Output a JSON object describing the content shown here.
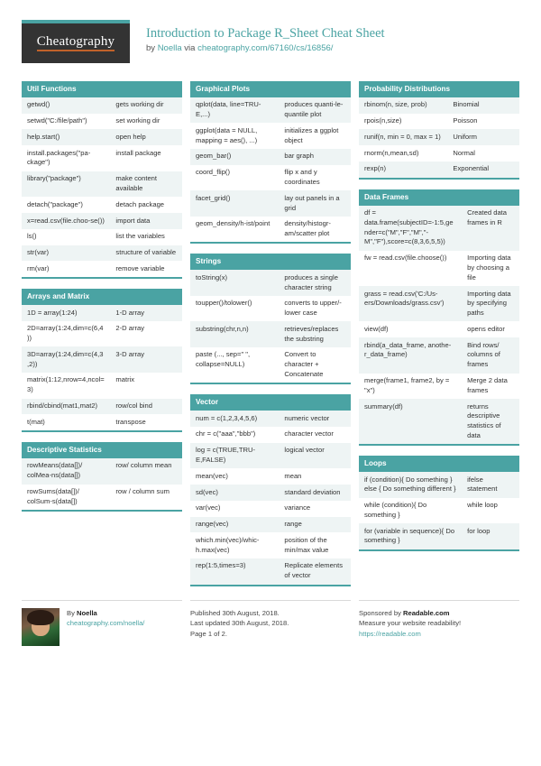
{
  "header": {
    "logo": "Cheatography",
    "title": "Introduction to Package R_Sheet Cheat Sheet",
    "by_prefix": "by ",
    "author": "Noella",
    "via": " via ",
    "source_url": "cheatography.com/67160/cs/16856/"
  },
  "columns": [
    {
      "name": "column-left",
      "blocks": [
        {
          "title": "Util Functions",
          "rows": [
            [
              "getwd()",
              "gets working dir"
            ],
            [
              "setwd(\"C:/file/path\")",
              "set working dir"
            ],
            [
              "help.start()",
              "open help"
            ],
            [
              "install.packages(\"pa-ckage\")",
              "install package"
            ],
            [
              "library(\"package\")",
              "make content available"
            ],
            [
              "detach(\"package\")",
              "detach package"
            ],
            [
              "x=read.csv(file.choo-se())",
              "import data"
            ],
            [
              "ls()",
              "list the variables"
            ],
            [
              "str(var)",
              "structure of variable"
            ],
            [
              "rm(var)",
              "remove variable"
            ]
          ]
        },
        {
          "title": "Arrays and Matrix",
          "rows": [
            [
              "1D = array(1:24)",
              "1-D array"
            ],
            [
              "2D=array(1:24,dim=c(6,4))",
              "2-D array"
            ],
            [
              "3D=array(1:24,dim=c(4,3,2))",
              "3-D array"
            ],
            [
              "matrix(1:12,nrow=4,ncol=3)",
              "matrix"
            ],
            [
              "rbind/cbind(mat1,mat2)",
              "row/col bind"
            ],
            [
              "t(mat)",
              "transpose"
            ]
          ]
        },
        {
          "title": "Descriptive Statistics",
          "rows": [
            [
              "rowMeans(data[])/ colMea-ns(data[])",
              "row/ column mean"
            ],
            [
              "rowSums(data[])/ colSum-s(data[])",
              "row / column sum"
            ]
          ]
        }
      ]
    },
    {
      "name": "column-middle",
      "blocks": [
        {
          "title": "Graphical Plots",
          "rows": [
            [
              "qplot(data, line=TRU-E,...)",
              "produces quanti-le-quantile plot"
            ],
            [
              "ggplot(data = NULL, mapping = aes(), ...)",
              "initializes a ggplot object"
            ],
            [
              "geom_bar()",
              "bar graph"
            ],
            [
              "coord_flip()",
              "flip x and y coordinates"
            ],
            [
              "facet_grid()",
              "lay out panels in a grid"
            ],
            [
              "geom_density/h-ist/point",
              "density/histogr-am/scatter plot"
            ]
          ]
        },
        {
          "title": "Strings",
          "rows": [
            [
              "toString(x)",
              "produces a single character string"
            ],
            [
              "toupper()/tolower()",
              "converts to upper/-lower case"
            ],
            [
              "substring(chr,n,n)",
              "retrieves/replaces the substring"
            ],
            [
              "paste (..., sep=\" \", collapse=NULL)",
              "Convert to character + Concatenate"
            ]
          ]
        },
        {
          "title": "Vector",
          "rows": [
            [
              "num = c(1,2,3,4,5,6)",
              "numeric vector"
            ],
            [
              "chr = c(\"aaa\",\"bbb\")",
              "character vector"
            ],
            [
              "log = c(TRUE,TRU-E,FALSE)",
              "logical vector"
            ],
            [
              "mean(vec)",
              "mean"
            ],
            [
              "sd(vec)",
              "standard deviation"
            ],
            [
              "var(vec)",
              "variance"
            ],
            [
              "range(vec)",
              "range"
            ],
            [
              "which.min(vec)/whic-h.max(vec)",
              "position of the min/max value"
            ],
            [
              "rep(1:5,times=3)",
              "Replicate elements of vector"
            ]
          ]
        }
      ]
    },
    {
      "name": "column-right",
      "blocks": [
        {
          "title": "Probability Distributions",
          "wide": false,
          "rows": [
            [
              "rbinom(n, size, prob)",
              "Binomial"
            ],
            [
              "rpois(n,size)",
              "Poisson"
            ],
            [
              "runif(n, min = 0, max = 1)",
              "Uniform"
            ],
            [
              "rnorm(n,mean,sd)",
              "Normal"
            ],
            [
              "rexp(n)",
              "Exponential"
            ]
          ]
        },
        {
          "title": "Data Frames",
          "wide": true,
          "rows": [
            [
              "df = data.frame(subjectID=-1:5,gender=c(\"M\",\"F\",\"M\",\"-M\",\"F\"),score=c(8,3,6,5,5))",
              "Created data frames in R"
            ],
            [
              "fw = read.csv(file.choose())",
              "Importing data by choosing a file"
            ],
            [
              "grass = read.csv('C:/Us-ers/Downloads/grass.csv')",
              "Importing data by specifying paths"
            ],
            [
              "view(df)",
              "opens editor"
            ],
            [
              "rbind(a_data_frame, anothe-r_data_frame)",
              "Bind rows/ columns of frames"
            ],
            [
              "merge(frame1, frame2, by = \"x\")",
              "Merge 2 data frames"
            ],
            [
              "summary(df)",
              "returns descriptive statistics of data"
            ]
          ]
        },
        {
          "title": "Loops",
          "wide": true,
          "rows": [
            [
              "if (condition){ Do something } else { Do something different }",
              "ifelse statement"
            ],
            [
              "while (condition){ Do something }",
              "while loop"
            ],
            [
              "for (variable in sequence){ Do something }",
              "for loop"
            ]
          ]
        }
      ]
    }
  ],
  "footer": {
    "author_prefix": "By ",
    "author_name": "Noella",
    "author_url": "cheatography.com/noella/",
    "published": "Published 30th August, 2018.",
    "updated": "Last updated 30th August, 2018.",
    "page": "Page 1 of 2.",
    "sponsor_prefix": "Sponsored by ",
    "sponsor_name": "Readable.com",
    "sponsor_tagline": "Measure your website readability!",
    "sponsor_url": "https://readable.com"
  }
}
